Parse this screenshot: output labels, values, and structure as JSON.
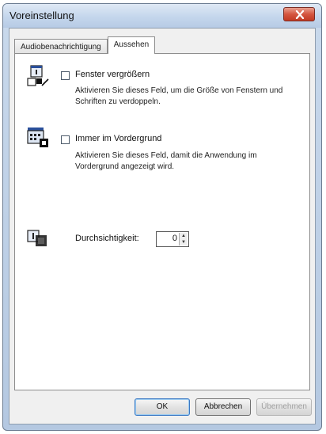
{
  "window": {
    "title": "Voreinstellung"
  },
  "tabs": [
    {
      "label": "Audiobenachrichtigung",
      "active": false
    },
    {
      "label": "Aussehen",
      "active": true
    }
  ],
  "options": {
    "enlarge": {
      "label": "Fenster vergrößern",
      "checked": false,
      "description": "Aktivieren Sie dieses Feld, um die Größe von Fenstern und Schriften zu verdoppeln."
    },
    "always_on_top": {
      "label": "Immer im Vordergrund",
      "checked": false,
      "description": "Aktivieren Sie dieses Feld, damit die Anwendung im Vordergrund angezeigt wird."
    },
    "transparency": {
      "label": "Durchsichtigkeit:",
      "value": "0"
    }
  },
  "buttons": {
    "ok": "OK",
    "cancel": "Abbrechen",
    "apply": "Übernehmen"
  },
  "icons": {
    "close": "close-icon",
    "enlarge": "enlarge-window-icon",
    "on_top": "window-on-top-icon",
    "transparency": "transparency-icon"
  }
}
